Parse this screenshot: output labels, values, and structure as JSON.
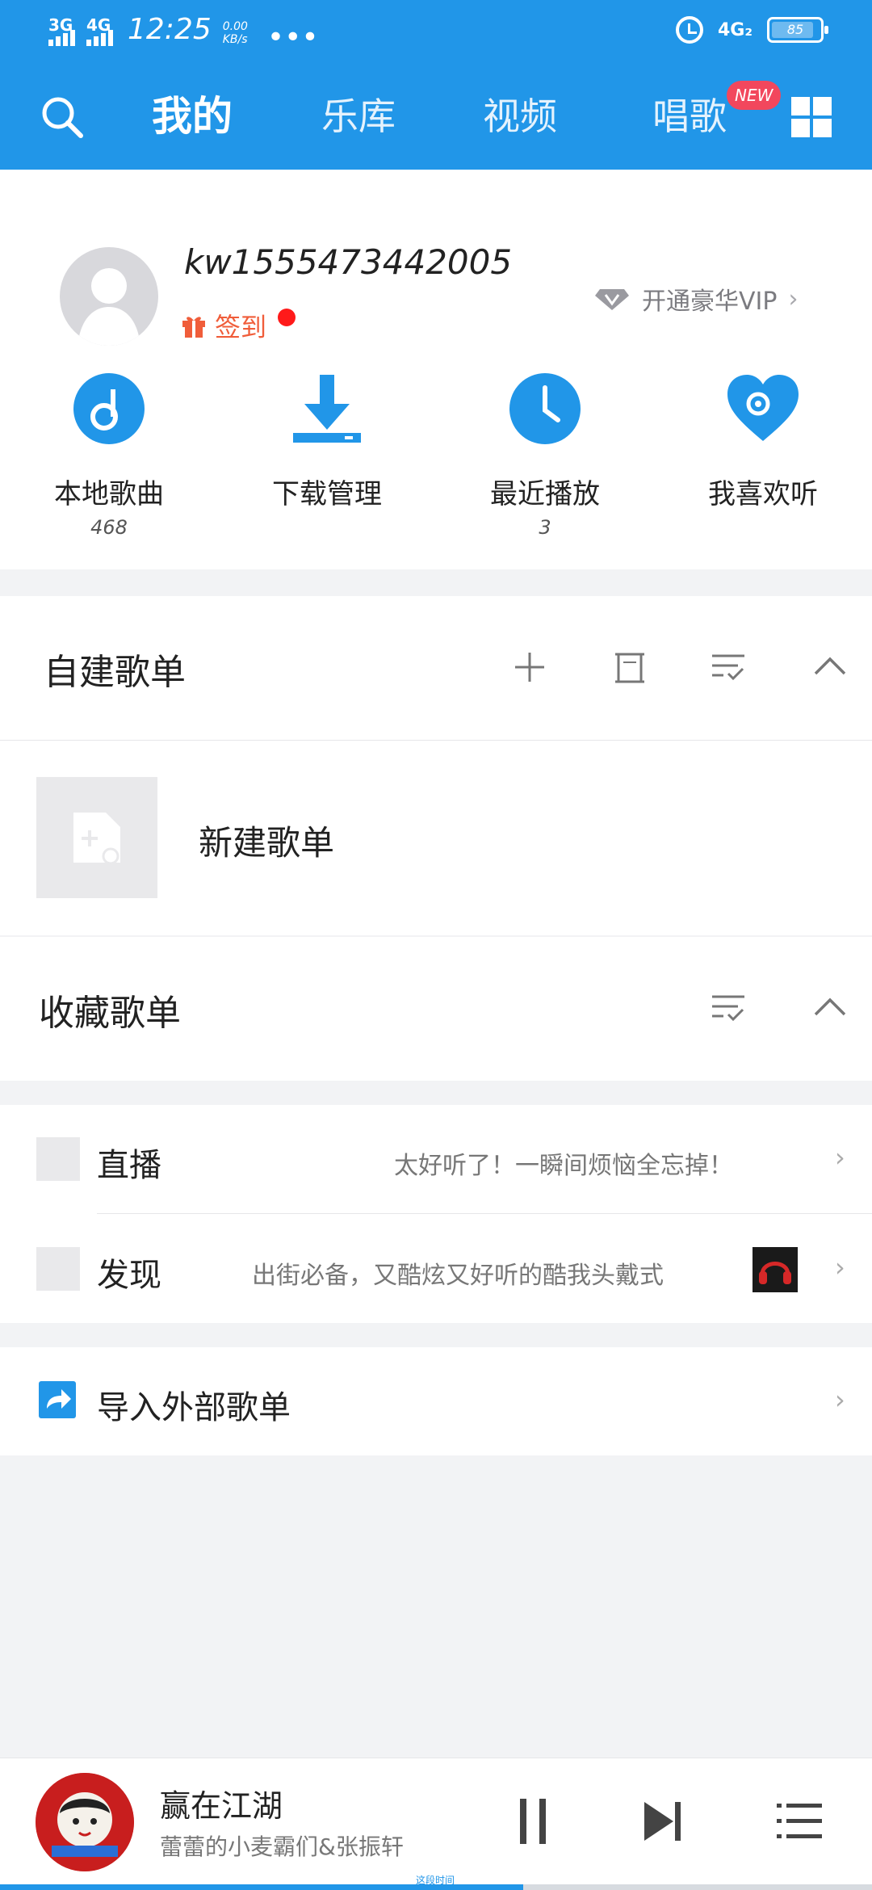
{
  "status_bar": {
    "signal1": "3G",
    "signal2": "4G",
    "time": "12:25",
    "speed_value": "0.00",
    "speed_unit": "KB/s",
    "more": "•••",
    "network": "4G₂",
    "battery": "85"
  },
  "nav": {
    "tabs": [
      {
        "label": "我的",
        "active": true
      },
      {
        "label": "乐库",
        "active": false
      },
      {
        "label": "视频",
        "active": false
      },
      {
        "label": "唱歌",
        "active": false
      }
    ],
    "new_badge": "NEW"
  },
  "profile": {
    "username": "kw1555473442005",
    "signin_label": "签到",
    "vip_label": "开通豪华VIP",
    "chevron": "›"
  },
  "shortcuts": [
    {
      "label": "本地歌曲",
      "count": "468",
      "icon": "music-note-icon"
    },
    {
      "label": "下载管理",
      "count": "",
      "icon": "download-icon"
    },
    {
      "label": "最近播放",
      "count": "3",
      "icon": "clock-icon"
    },
    {
      "label": "我喜欢听",
      "count": "",
      "icon": "heart-icon"
    }
  ],
  "custom_playlists": {
    "title": "自建歌单",
    "new_playlist_label": "新建歌单"
  },
  "collected_playlists": {
    "title": "收藏歌单"
  },
  "rows": [
    {
      "label": "直播",
      "subtitle": "太好听了！一瞬间烦恼全忘掉！"
    },
    {
      "label": "发现",
      "subtitle": "出街必备，又酷炫又好听的酷我头戴式"
    }
  ],
  "import": {
    "label": "导入外部歌单"
  },
  "player": {
    "title": "赢在江湖",
    "artist": "蕾蕾的小麦霸们&张振轩",
    "progress": 0.6,
    "mini_text": "这段时间"
  },
  "colors": {
    "primary": "#2196e8",
    "accent_orange": "#f05d3a",
    "badge_red": "#f2475d"
  }
}
